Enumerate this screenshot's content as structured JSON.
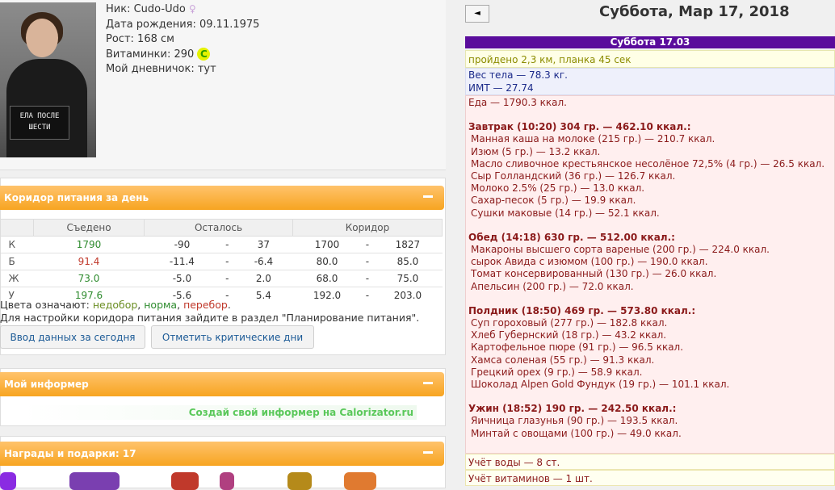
{
  "profile": {
    "nick_label": "Ник:",
    "nick": "Cudo-Udo",
    "birth_label": "Дата рождения:",
    "birth": "09.11.1975",
    "height_label": "Рост:",
    "height": "168 см",
    "vit_label": "Витаминки:",
    "vit": "290",
    "vit_coin": "С",
    "diary_label": "Мой дневничок:",
    "diary": "тут",
    "photo_sign_1": "ЕЛА ПОСЛЕ",
    "photo_sign_2": "ШЕСТИ"
  },
  "corridor": {
    "title": "Коридор питания за день",
    "headers": [
      "Съедено",
      "Осталось",
      "Коридор"
    ],
    "rows": [
      {
        "k": "К",
        "eaten": "1790",
        "r1": "-90",
        "dash1": "-",
        "r2": "37",
        "c1": "1700",
        "dash2": "-",
        "c2": "1827"
      },
      {
        "k": "Б",
        "eaten": "91.4",
        "r1": "-11.4",
        "dash1": "-",
        "r2": "-6.4",
        "c1": "80.0",
        "dash2": "-",
        "c2": "85.0"
      },
      {
        "k": "Ж",
        "eaten": "73.0",
        "r1": "-5.0",
        "dash1": "-",
        "r2": "2.0",
        "c1": "68.0",
        "dash2": "-",
        "c2": "75.0"
      },
      {
        "k": "У",
        "eaten": "197.6",
        "r1": "-5.6",
        "dash1": "-",
        "r2": "5.4",
        "c1": "192.0",
        "dash2": "-",
        "c2": "203.0"
      }
    ],
    "legend_prefix": "Цвета означают: ",
    "legend_under": "недобор",
    "legend_norm": "норма",
    "legend_over": "перебор",
    "legend_sep": ", ",
    "legend_end": ".",
    "legend_line2": "Для настройки коридора питания зайдите в раздел \"Планирование питания\".",
    "btn_today": "Ввод данных за сегодня",
    "btn_crit": "Отметить критические дни"
  },
  "informer": {
    "title": "Мой информер",
    "text": "Создай свой информер на Calorizator.ru"
  },
  "awards": {
    "title": "Награды и подарки: 17"
  },
  "right": {
    "back": "◄",
    "date": "Суббота, Мар 17, 2018",
    "day_header": "Суббота 17.03",
    "activity": "пройдено 2,3 км, планка 45 сек",
    "weight": "Вес тела — 78.3 кг.",
    "bmi": "ИМТ — 27.74",
    "food_total": "Еда — 1790.3 ккал.",
    "meals": [
      {
        "title": "Завтрак (10:20) 304 гр. — 462.10 ккал.:",
        "items": [
          "Манная каша на молоке (215 гр.) — 210.7 ккал.",
          "Изюм (5 гр.) — 13.2 ккал.",
          "Масло сливочное крестьянское несолёное 72,5% (4 гр.) — 26.5 ккал.",
          "Сыр Голландский (36 гр.) — 126.7 ккал.",
          "Молоко 2.5% (25 гр.) — 13.0 ккал.",
          "Сахар-песок (5 гр.) — 19.9 ккал.",
          "Сушки маковые (14 гр.) — 52.1 ккал."
        ]
      },
      {
        "title": "Обед (14:18) 630 гр. — 512.00 ккал.:",
        "items": [
          "Макароны высшего сорта вареные (200 гр.) — 224.0 ккал.",
          "сырок Авида с изюмом (100 гр.) — 190.0 ккал.",
          "Томат консервированный (130 гр.) — 26.0 ккал.",
          "Апельсин (200 гр.) — 72.0 ккал."
        ]
      },
      {
        "title": "Полдник (18:50) 469 гр. — 573.80 ккал.:",
        "items": [
          "Суп гороховый (277 гр.) — 182.8 ккал.",
          "Хлеб Губернский (18 гр.) — 43.2 ккал.",
          "Картофельное пюре (91 гр.) — 96.5 ккал.",
          "Хамса соленая (55 гр.) — 91.3 ккал.",
          "Грецкий орех (9 гр.) — 58.9 ккал.",
          "Шоколад Alpen Gold Фундук (19 гр.) — 101.1 ккал."
        ]
      },
      {
        "title": "Ужин (18:52) 190 гр. — 242.50 ккал.:",
        "items": [
          "Яичница глазунья (90 гр.) — 193.5 ккал.",
          "Минтай с овощами (100 гр.) — 49.0 ккал."
        ]
      }
    ],
    "water": "Учёт воды — 8 ст.",
    "vitamins": "Учёт витаминов — 1 шт."
  },
  "colors": {
    "accent": "#f7a521",
    "header": "#5a0c9c",
    "food_bg": "#ffefef"
  },
  "icons": [
    "female-icon",
    "vitamin-coin-icon",
    "minus-icon",
    "back-arrow-icon"
  ]
}
